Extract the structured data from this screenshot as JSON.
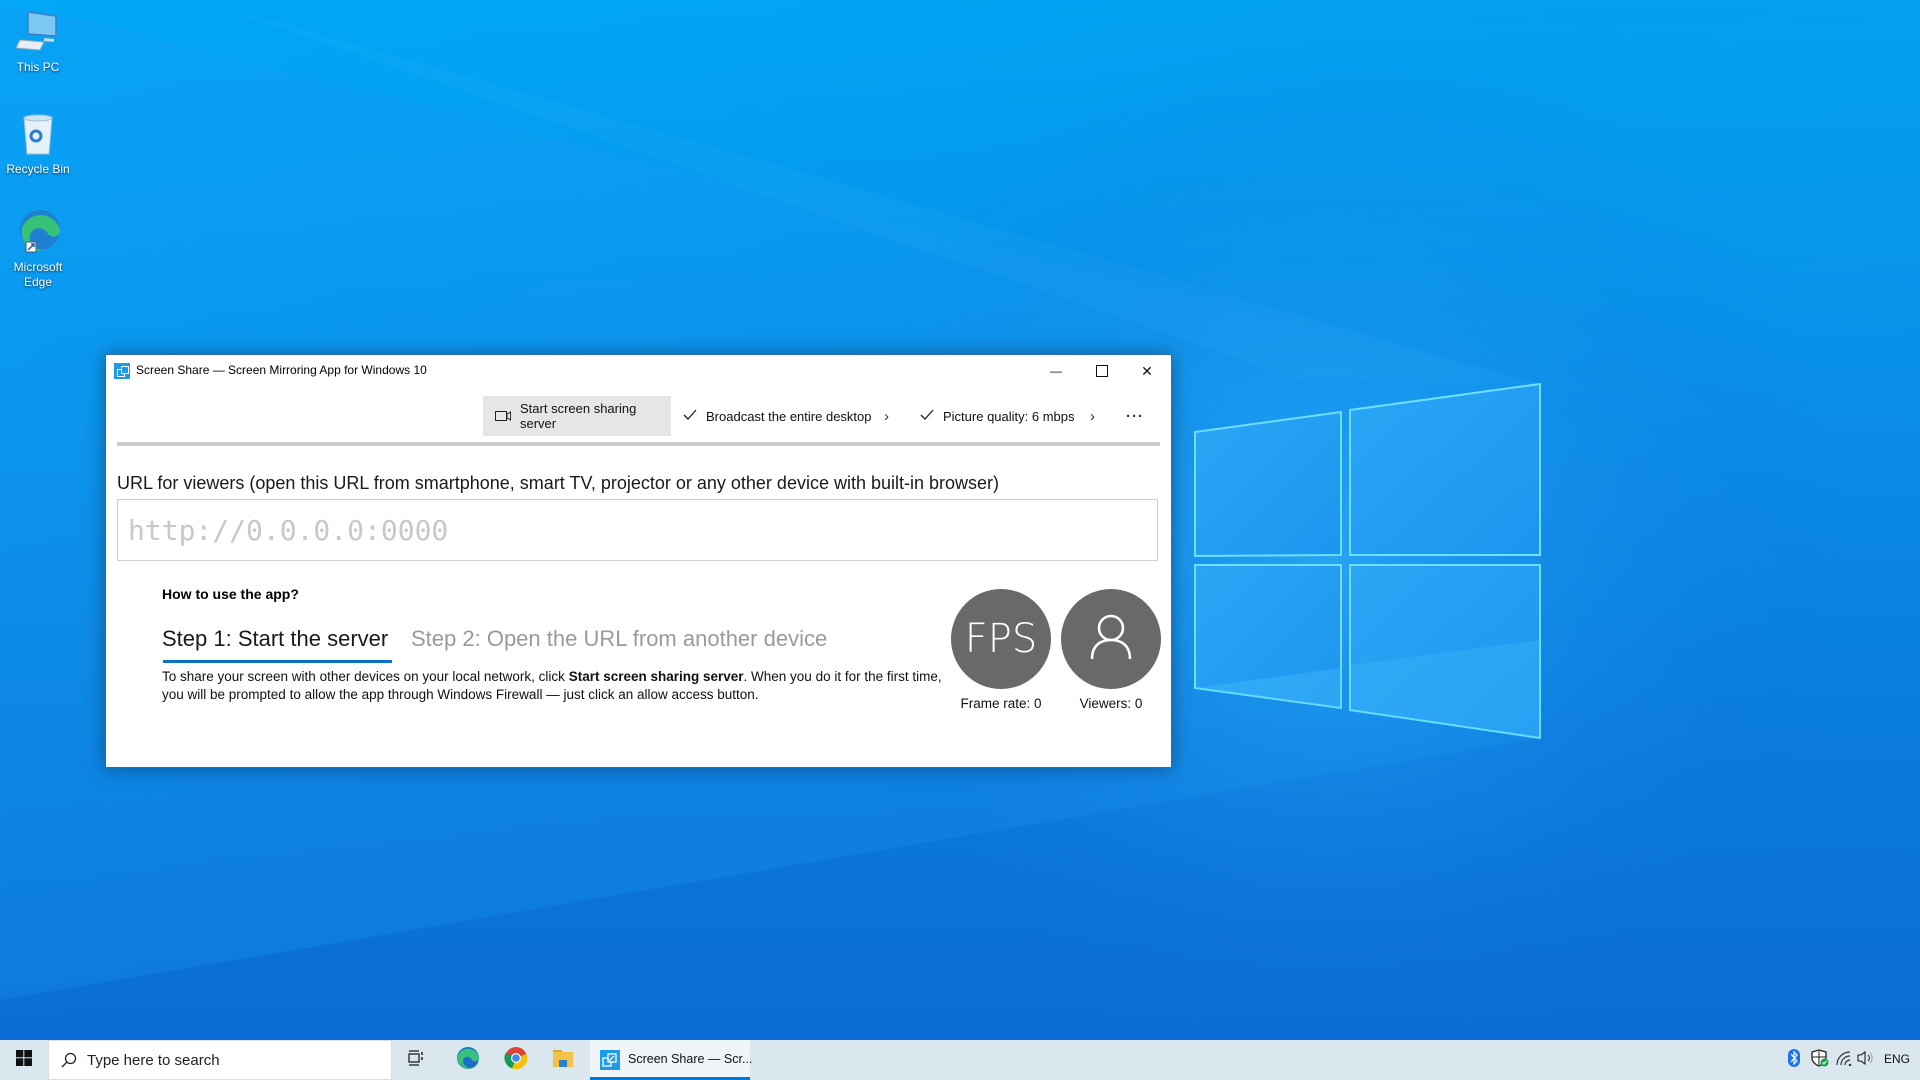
{
  "desktop": {
    "icons": [
      {
        "label": "This PC",
        "icon": "this-pc-icon"
      },
      {
        "label": "Recycle Bin",
        "icon": "recycle-bin-icon"
      },
      {
        "label": "Microsoft Edge",
        "icon": "edge-icon"
      }
    ]
  },
  "window": {
    "title": "Screen Share — Screen Mirroring App for Windows 10",
    "controls": {
      "minimize": "—",
      "maximize": "□",
      "close": "✕"
    },
    "commandbar": {
      "start_server": "Start screen sharing server",
      "broadcast": "Broadcast the entire desktop",
      "broadcast_checked": true,
      "quality": "Picture quality: 6 mbps",
      "quality_checked": true,
      "more": "···"
    },
    "progress": 0,
    "url_label": "URL for viewers (open this URL from smartphone, smart TV, projector or any other device with built-in browser)",
    "url_value": "",
    "url_placeholder": "http://0.0.0.0:0000",
    "howto_title": "How to use the app?",
    "steps": [
      {
        "label": "Step 1: Start the server",
        "active": true
      },
      {
        "label": "Step 2: Open the URL from another device",
        "active": false
      }
    ],
    "description": {
      "before": "To share your screen with other devices on your local network, click ",
      "bold": "Start screen sharing server",
      "after": ". When you do it for the first time, you will be prompted to allow the app through Windows Firewall — just click an allow access button."
    },
    "stats": {
      "fps_badge": "FPS",
      "frame_rate_label": "Frame rate: 0",
      "viewers_label": "Viewers: 0"
    }
  },
  "taskbar": {
    "search_placeholder": "Type here to search",
    "pinned": [
      "task-view",
      "microsoft-edge",
      "google-chrome",
      "file-explorer"
    ],
    "active_app_label": "Screen Share — Scr...",
    "tray": [
      "bluetooth",
      "windows-security",
      "network",
      "volume"
    ],
    "language": "ENG"
  },
  "colors": {
    "accent": "#0078d7",
    "tab_underline": "#0a73c8",
    "stat_circle": "#696969",
    "command_button_bg": "#e6e6e6",
    "taskbar_bg": "#dbe7ee"
  }
}
